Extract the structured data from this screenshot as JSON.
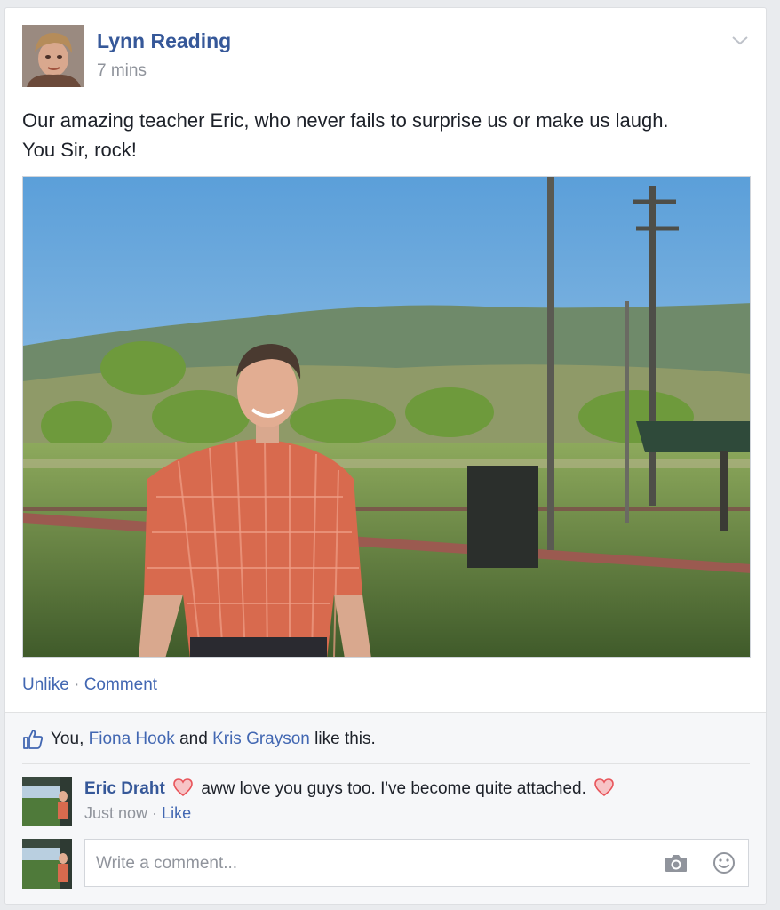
{
  "post": {
    "author": "Lynn Reading",
    "time": "7 mins",
    "text": "Our amazing teacher Eric, who never fails to surprise us or make us laugh.\nYou Sir, rock!",
    "actions": {
      "unlike": "Unlike",
      "separator": "·",
      "comment": "Comment"
    }
  },
  "likes": {
    "prefix": "You, ",
    "person1": "Fiona Hook",
    "connector": " and ",
    "person2": "Kris Grayson",
    "suffix": " like this."
  },
  "comments": [
    {
      "author": "Eric Draht",
      "text": "aww love you guys too. I've become quite attached.",
      "time": "Just now",
      "separator": "·",
      "like": "Like"
    }
  ],
  "composer": {
    "placeholder": "Write a comment..."
  },
  "colors": {
    "link": "#365899",
    "accent": "#4267b2",
    "heart": "#e8545a",
    "muted": "#90949c"
  },
  "icons": {
    "menu": "chevron-down-icon",
    "like": "thumbs-up-icon",
    "reaction": "heart-icon",
    "camera": "camera-icon",
    "emoji": "smiley-icon"
  }
}
